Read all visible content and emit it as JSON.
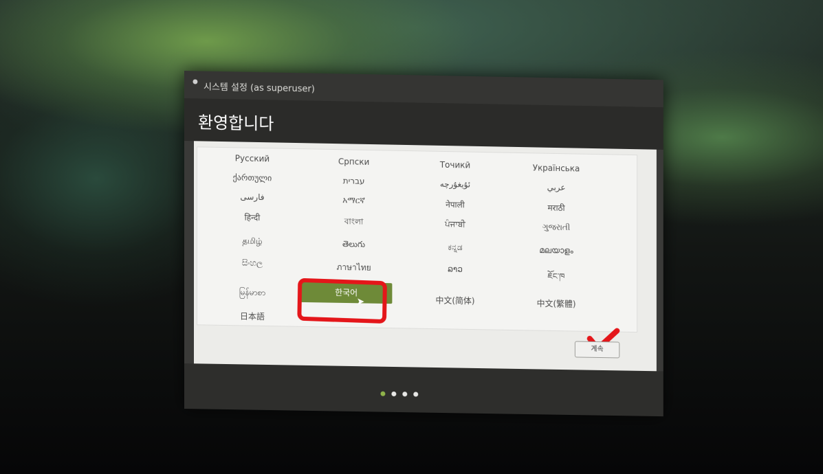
{
  "window": {
    "title": "시스템 설정 (as superuser)",
    "welcome": "환영합니다"
  },
  "languages": [
    {
      "label": "Русский"
    },
    {
      "label": "Српски"
    },
    {
      "label": "Точикӣ"
    },
    {
      "label": "Українська"
    },
    {
      "label": "ქართული"
    },
    {
      "label": "עברית"
    },
    {
      "label": "ئۇيغۇرچە"
    },
    {
      "label": "عربي"
    },
    {
      "label": "فارسی"
    },
    {
      "label": "አማርኛ"
    },
    {
      "label": "नेपाली"
    },
    {
      "label": "मराठी"
    },
    {
      "label": "हिन्दी"
    },
    {
      "label": "বাংলা"
    },
    {
      "label": "ਪੰਜਾਬੀ"
    },
    {
      "label": "ગુજરાતી"
    },
    {
      "label": "தமிழ்"
    },
    {
      "label": "తెలుగు"
    },
    {
      "label": "ಕನ್ನಡ"
    },
    {
      "label": "മലയാളം"
    },
    {
      "label": "සිංහල"
    },
    {
      "label": "ภาษาไทย"
    },
    {
      "label": "ລາວ"
    },
    {
      "label": "ཇོང་ཁ"
    },
    {
      "label": "မြန်မာစာ"
    },
    {
      "label": "한국어",
      "selected": true
    },
    {
      "label": "中文(简体)"
    },
    {
      "label": "中文(繁體)"
    },
    {
      "label": "日本語"
    }
  ],
  "continue_button": "계속",
  "pager": {
    "total": 4,
    "active": 1
  },
  "colors": {
    "accent": "#6e8a38",
    "annotation": "#e4161a"
  }
}
